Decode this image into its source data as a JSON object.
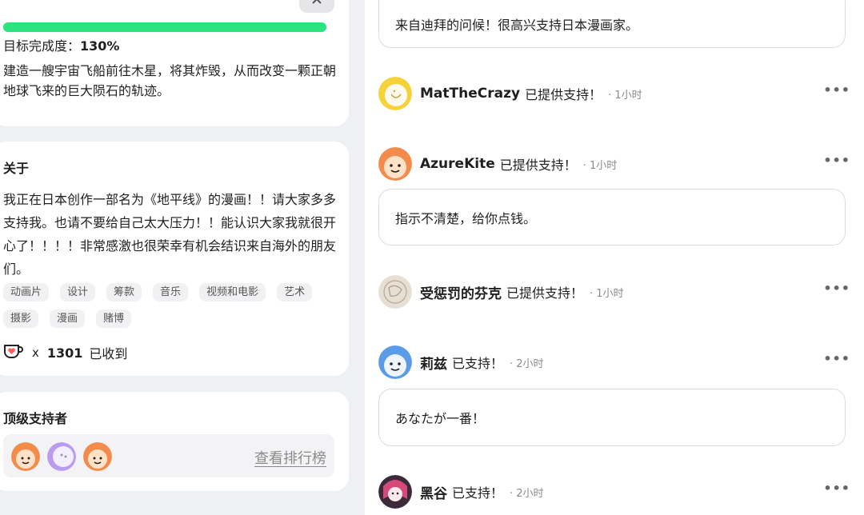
{
  "goal": {
    "collapse_icon": "chevron-up-icon",
    "progress_percent": 130,
    "progress_label": "目标完成度：",
    "progress_value": "130%",
    "description": "建造一艘宇宙飞船前往木星，将其炸毁，从而改变一颗正朝地球飞来的巨大陨石的轨迹。",
    "progress_color": "#2ae47d"
  },
  "about": {
    "title": "关于",
    "text": "我正在日本创作一部名为《地平线》的漫画！！请大家多多支持我。也请不要给自己太大压力！！能认识大家我就很开心了！！！！非常感激也很荣幸有机会结识来自海外的朋友们。",
    "tags": [
      "动画片",
      "设计",
      "筹款",
      "音乐",
      "视频和电影",
      "艺术",
      "摄影",
      "漫画",
      "赌博"
    ],
    "received_icon": "coffee-cup-icon",
    "received_x": "x",
    "received_count": "1301",
    "received_label": "已收到"
  },
  "top_supporters": {
    "title": "顶级支持者",
    "leaderboard_link": "查看排行榜"
  },
  "feed": {
    "top_message": "来自迪拜的问候！很高兴支持日本漫画家。",
    "entries": [
      {
        "name": "MatTheCrazy",
        "action": "已提供支持！",
        "time": "· 1小时"
      },
      {
        "name": "AzureKite",
        "action": "已提供支持！",
        "time": "· 1小时"
      },
      {
        "name": "受惩罚的芬克",
        "action": "已提供支持！",
        "time": "· 1小时"
      },
      {
        "name": "莉兹",
        "action": "已支持！",
        "time": "· 2小时"
      },
      {
        "name": "黑谷",
        "action": "已支持！",
        "time": "· 2小时"
      }
    ],
    "messages": [
      "指示不清楚，给你点钱。",
      "あなたが一番！"
    ],
    "more_icon": "more-horizontal-icon",
    "more_glyph": "•••"
  }
}
